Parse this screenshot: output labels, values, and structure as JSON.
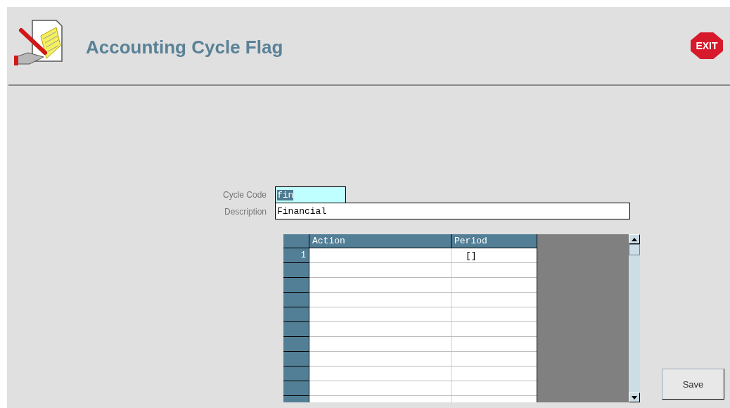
{
  "header": {
    "title": "Accounting Cycle Flag",
    "exit": "EXIT"
  },
  "form": {
    "fields": [
      {
        "label": "Cycle Code",
        "value": "fin",
        "kind": "code"
      },
      {
        "label": "Description",
        "value": "Financial",
        "kind": "text"
      }
    ]
  },
  "table": {
    "columns": [
      "Action",
      "Period"
    ],
    "rows": [
      {
        "number": "1",
        "period": "[]"
      },
      {},
      {},
      {},
      {},
      {},
      {},
      {},
      {},
      {},
      {}
    ]
  },
  "buttons": [
    "Save"
  ]
}
